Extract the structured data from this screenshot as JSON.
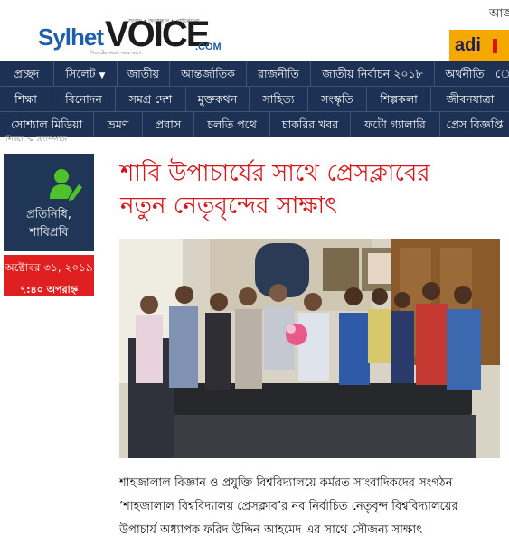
{
  "header": {
    "logo_sylhet": "Sylhet",
    "logo_voice": "VOICE",
    "logo_dotcom": ".COM",
    "logo_tagline": "সংবাদ • অনুসন্ধান • পর্যালোচনা",
    "logo_tagline2": "সিলেটের সংবাদ সবার আগে",
    "top_right_text": "আজ",
    "ad_text": "adi"
  },
  "nav": {
    "row1": [
      "প্রচ্ছদ",
      "সিলেট",
      "জাতীয়",
      "আন্তর্জাতিক",
      "রাজনীতি",
      "জাতীয় নির্বাচন ২০১৮",
      "অর্থনীতি",
      "ে"
    ],
    "row2": [
      "শিক্ষা",
      "বিনোদন",
      "সমগ্র দেশ",
      "মুক্তকথন",
      "সাহিত্য",
      "সংস্কৃতি",
      "শিল্পকলা",
      "জীবনযাত্রা"
    ],
    "row3": [
      "সোশ্যাল মিডিয়া",
      "ভ্রমণ",
      "প্রবাস",
      "চলতি পথে",
      "চাকরির খবর",
      "ফটো গ্যালারি",
      "প্রেস বিজ্ঞপ্তি"
    ]
  },
  "breadcrumb": "শিক্ষা > ক্যাম্পাস",
  "author": {
    "icon": "user-edit-icon",
    "name_line1": "প্রতিনিধি,",
    "name_line2": "শাবিপ্রবি",
    "date": "অক্টোবর ৩১, ২০১৯",
    "time": "৭:৪০ অপরাহ্ন"
  },
  "article": {
    "title_line1": "শাবি উপাচার্যের সাথে প্রেসক্লাবের",
    "title_line2": "নতুন নেতৃবৃন্দের সাক্ষাৎ",
    "body_line1": "শাহজালাল বিজ্ঞান ও প্রযুক্তি বিশ্ববিদ্যালয়ে কর্মরত সাংবাদিকদের সংগঠন",
    "body_line2": "‘শাহজালাল বিশ্ববিদ্যালয় প্রেসক্লাব’র নব নির্বাচিত নেতৃবৃন্দ বিশ্ববিদ্যালয়ের",
    "body_line3": "উপাচার্য অধ্যাপক ফরিদ উদ্দিন আহমেদ এর সাথে সৌজন্য সাক্ষাৎ"
  },
  "colors": {
    "nav_bg": "#1c3153",
    "title_red": "#d8141b",
    "date_red": "#e02020",
    "brand_blue": "#1e5fa8",
    "ad_orange": "#f5a800"
  }
}
